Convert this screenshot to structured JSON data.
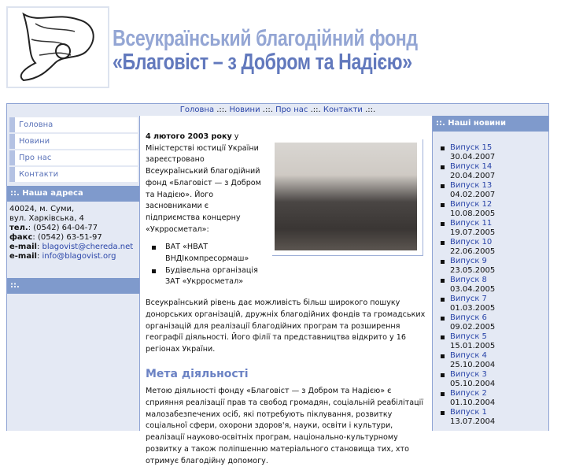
{
  "header": {
    "title_line1": "Всеукраїнський благодійний фонд",
    "title_line2": "«Благовіст – з Добром та Надією»"
  },
  "topnav": {
    "items": [
      "Головна",
      "Новини",
      "Про нас",
      "Контакти"
    ],
    "separator": " .::. ",
    "end": " .::."
  },
  "menu": [
    "Головна",
    "Новини",
    "Про нас",
    "Контакти"
  ],
  "address": {
    "heading": "::. Наша адреса",
    "line1": "40024, м. Суми,",
    "line2": "вул. Харківська, 4",
    "tel_label": "тел.",
    "tel": ": (0542) 64-04-77",
    "fax_label": "факс",
    "fax": ": (0542) 63-51-97",
    "email_label": "e-mail",
    "email1": "blagovist@chereda.net",
    "email2": "info@blagovist.org",
    "heading2": "::."
  },
  "content": {
    "intro_bold": "4 лютого 2003 року",
    "intro": " у Міністерстві юстиції України зареєстровано Всеукраїнський благодійний фонд «Благовіст — з Добром та Надією». Його засновниками є підприємства концерну «Укрросметал»:",
    "founders": [
      "ВАТ «НВАТ ВНДІкомпресормаш»",
      "Будівельна організація ЗАТ «Укрросметал»"
    ],
    "para2": "Всеукраїнський рівень дає можливість більш широкого пошуку донорських організацій, дружніх благодійних фондів та громадських організацій для реалізації благодійних програм та розширення географії діяльності. Його філії та представництва відкрито у 16 регіонах України.",
    "heading": "Мета діяльності",
    "para3": "Метою діяльності фонду «Благовіст — з Добром та Надією» є сприяння реалізації прав та свобод громадян, соціальній реабілітації малозабезпечених осіб, які потребують піклування, розвитку соціальної сфери, охорони здоров'я, науки, освіти і культури, реалізації науково-освітніх програм, національно-культурному розвитку а також поліпшенню матеріального становища тих, хто отримує благодійну допомогу."
  },
  "news": {
    "heading": "::. Наші новини",
    "items": [
      {
        "label": "Випуск 15",
        "date": "30.04.2007"
      },
      {
        "label": "Випуск 14",
        "date": "20.04.2007"
      },
      {
        "label": "Випуск 13",
        "date": "04.02.2007"
      },
      {
        "label": "Випуск 12",
        "date": "10.08.2005"
      },
      {
        "label": "Випуск 11",
        "date": "19.07.2005"
      },
      {
        "label": "Випуск 10",
        "date": "22.06.2005"
      },
      {
        "label": "Випуск 9",
        "date": "23.05.2005"
      },
      {
        "label": "Випуск 8",
        "date": "03.04.2005"
      },
      {
        "label": "Випуск 7",
        "date": "01.03.2005"
      },
      {
        "label": "Випуск 6",
        "date": "09.02.2005"
      },
      {
        "label": "Випуск 5",
        "date": "15.01.2005"
      },
      {
        "label": "Випуск 4",
        "date": "25.10.2004"
      },
      {
        "label": "Випуск 3",
        "date": "05.10.2004"
      },
      {
        "label": "Випуск 2",
        "date": "01.10.2004"
      },
      {
        "label": "Випуск 1",
        "date": "13.07.2004"
      }
    ]
  }
}
